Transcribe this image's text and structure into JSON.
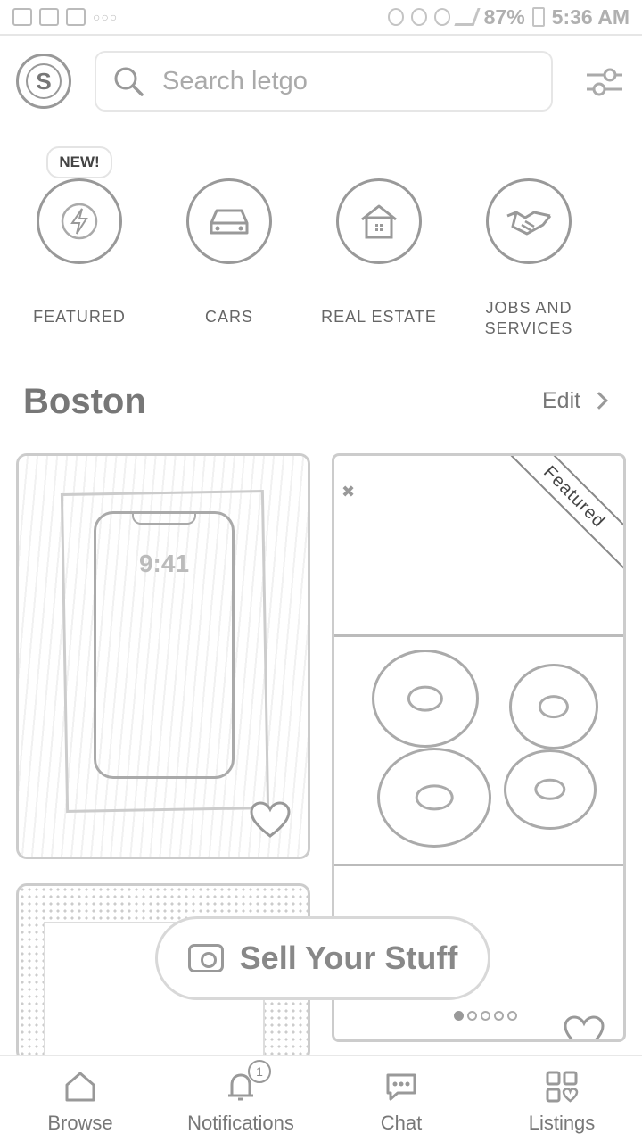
{
  "status_bar": {
    "battery": "87%",
    "time": "5:36 AM"
  },
  "header": {
    "avatar_letter": "S",
    "search_placeholder": "Search letgo"
  },
  "categories": [
    {
      "label": "FEATURED",
      "badge": "NEW!",
      "icon": "lightning-icon"
    },
    {
      "label": "CARS",
      "icon": "car-icon"
    },
    {
      "label": "REAL ESTATE",
      "icon": "house-icon"
    },
    {
      "label": "JOBS AND SERVICES",
      "icon": "handshake-icon"
    }
  ],
  "section": {
    "location": "Boston",
    "edit_label": "Edit"
  },
  "listings": [
    {
      "image": "phone-in-box",
      "phone_clock": "9:41"
    },
    {
      "image": "donuts",
      "ribbon": "Featured"
    },
    {
      "image": "sprinkles"
    }
  ],
  "sell_button": {
    "label": "Sell Your Stuff"
  },
  "bottom_nav": [
    {
      "label": "Browse",
      "icon": "home-icon"
    },
    {
      "label": "Notifications",
      "icon": "bell-icon",
      "badge": "1"
    },
    {
      "label": "Chat",
      "icon": "chat-icon"
    },
    {
      "label": "Listings",
      "icon": "grid-heart-icon"
    }
  ]
}
